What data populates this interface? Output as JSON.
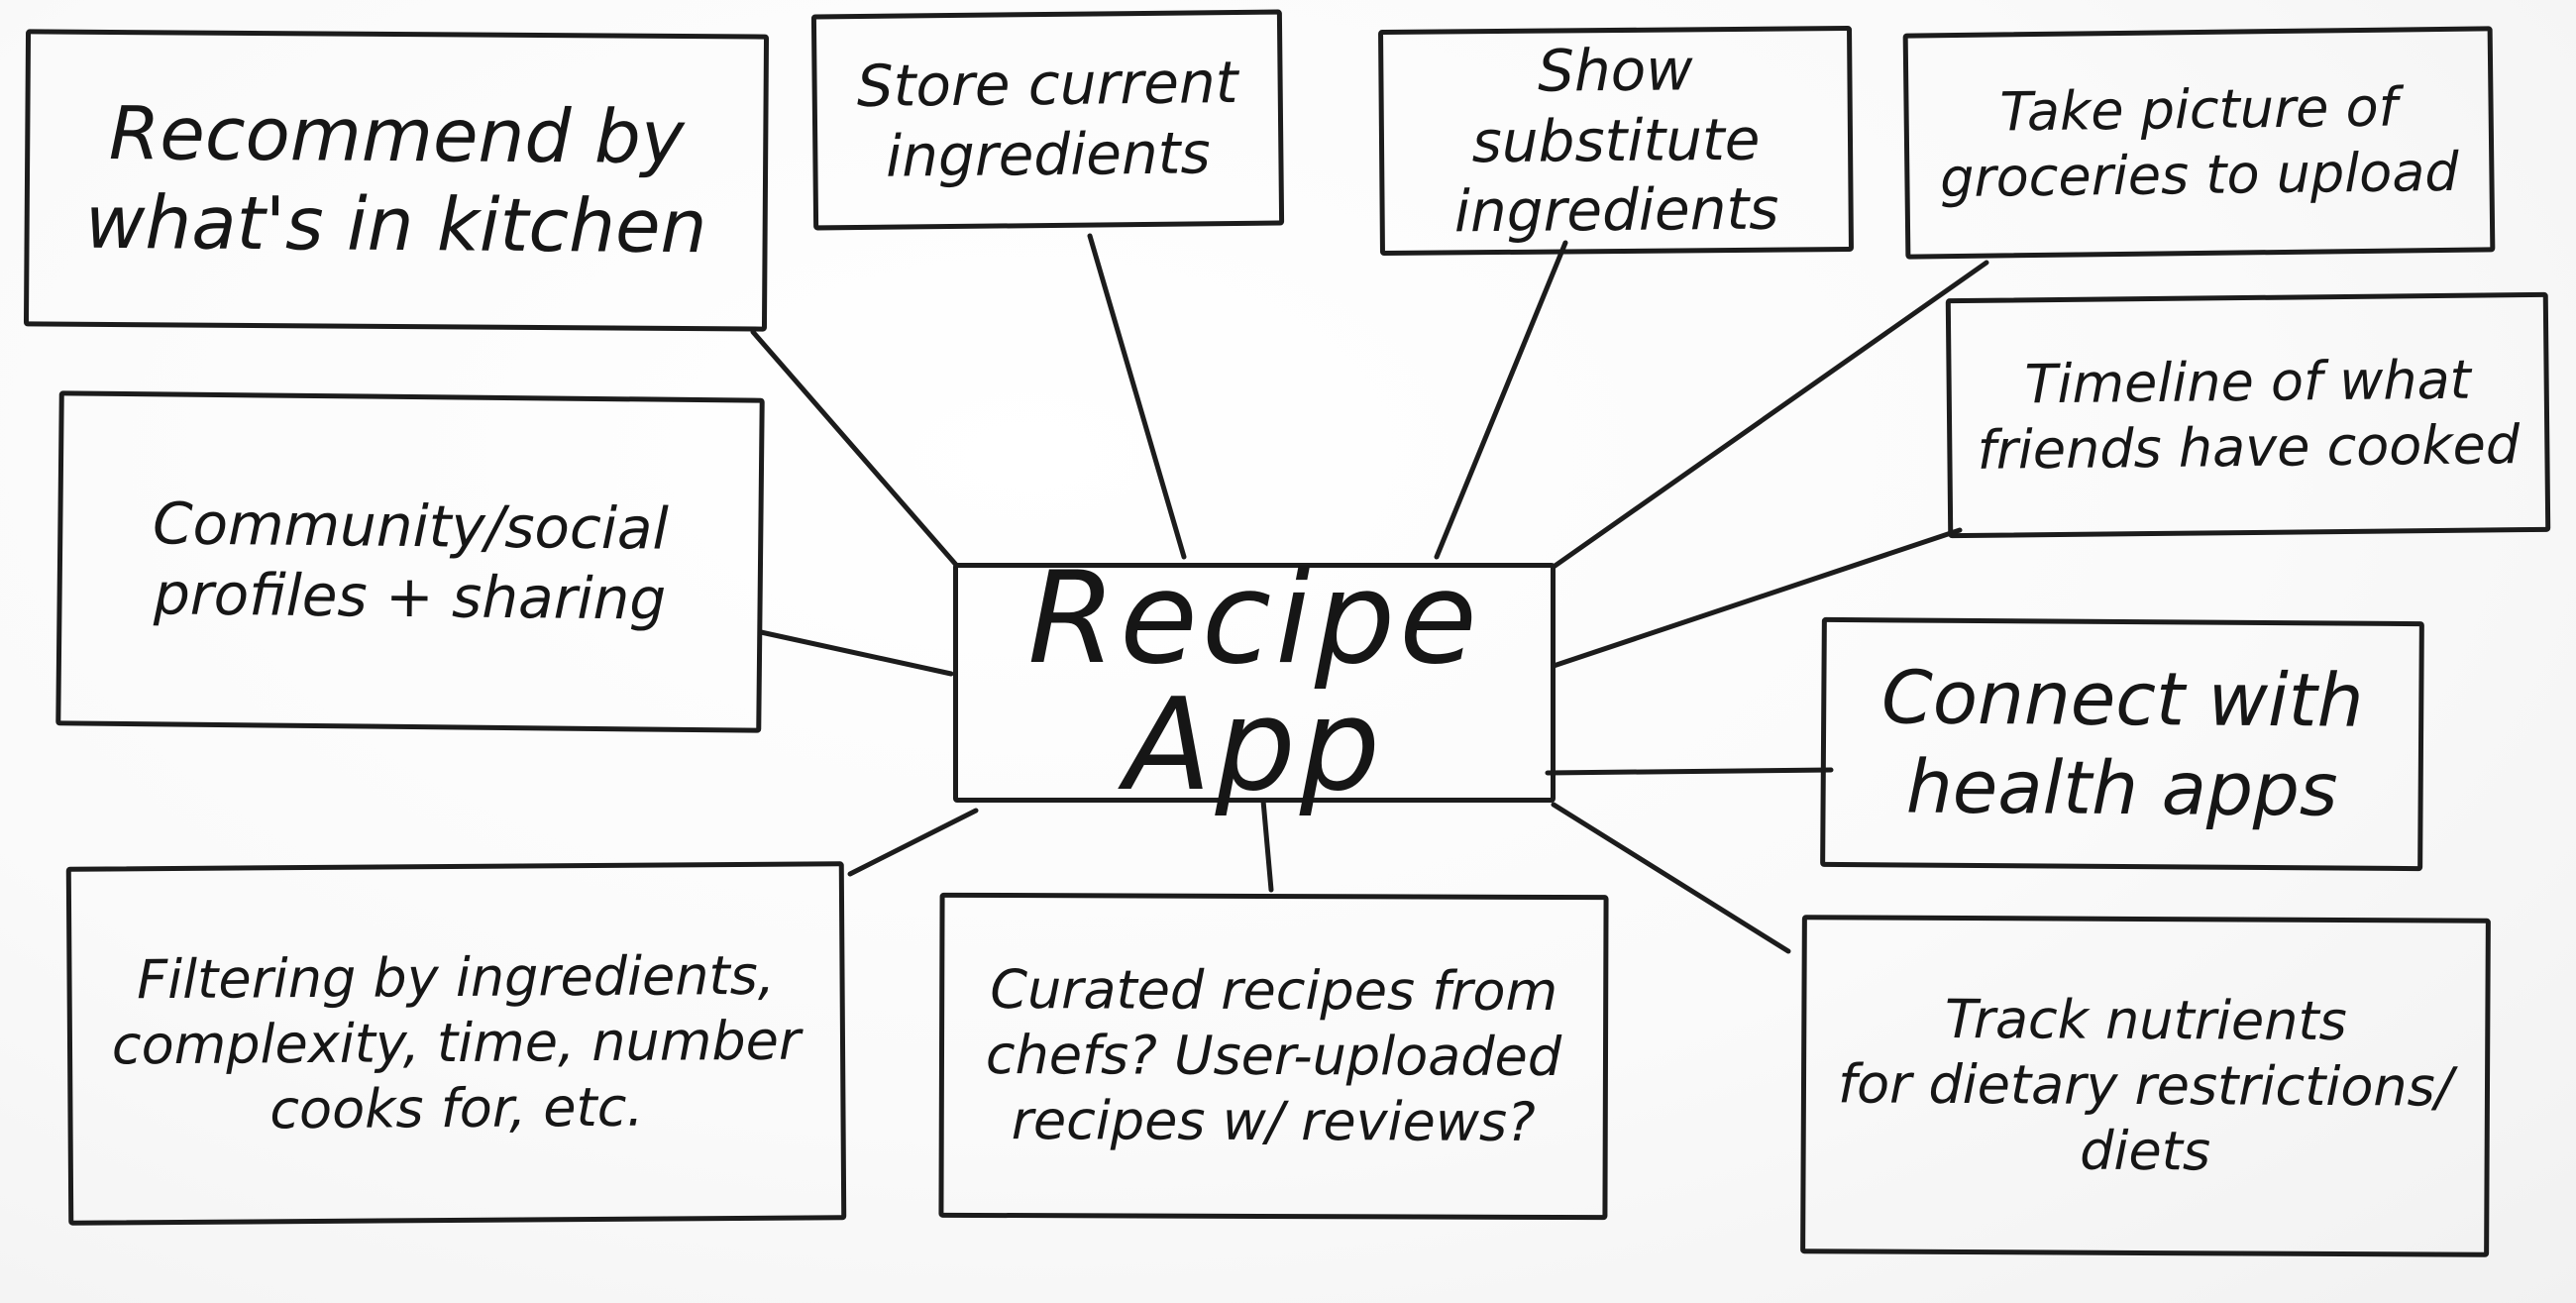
{
  "diagram": {
    "center": {
      "label": "Recipe App"
    },
    "nodes": [
      {
        "id": "recommend",
        "label": "Recommend by\nwhat's in kitchen"
      },
      {
        "id": "store",
        "label": "Store current\ningredients"
      },
      {
        "id": "substitute",
        "label": "Show substitute\ningredients"
      },
      {
        "id": "picture",
        "label": "Take picture of\ngroceries to upload"
      },
      {
        "id": "timeline",
        "label": "Timeline of what\nfriends have cooked"
      },
      {
        "id": "community",
        "label": "Community/social\nprofiles + sharing"
      },
      {
        "id": "health",
        "label": "Connect with\nhealth apps"
      },
      {
        "id": "filtering",
        "label": "Filtering by ingredients,\ncomplexity, time, number\ncooks for, etc."
      },
      {
        "id": "curated",
        "label": "Curated recipes from\nchefs? User-uploaded\nrecipes w/ reviews?"
      },
      {
        "id": "nutrients",
        "label": "Track nutrients\nfor dietary restrictions/\ndiets"
      }
    ],
    "colors": {
      "ink": "#1c1c1c",
      "board": "#fdfdfd"
    }
  }
}
